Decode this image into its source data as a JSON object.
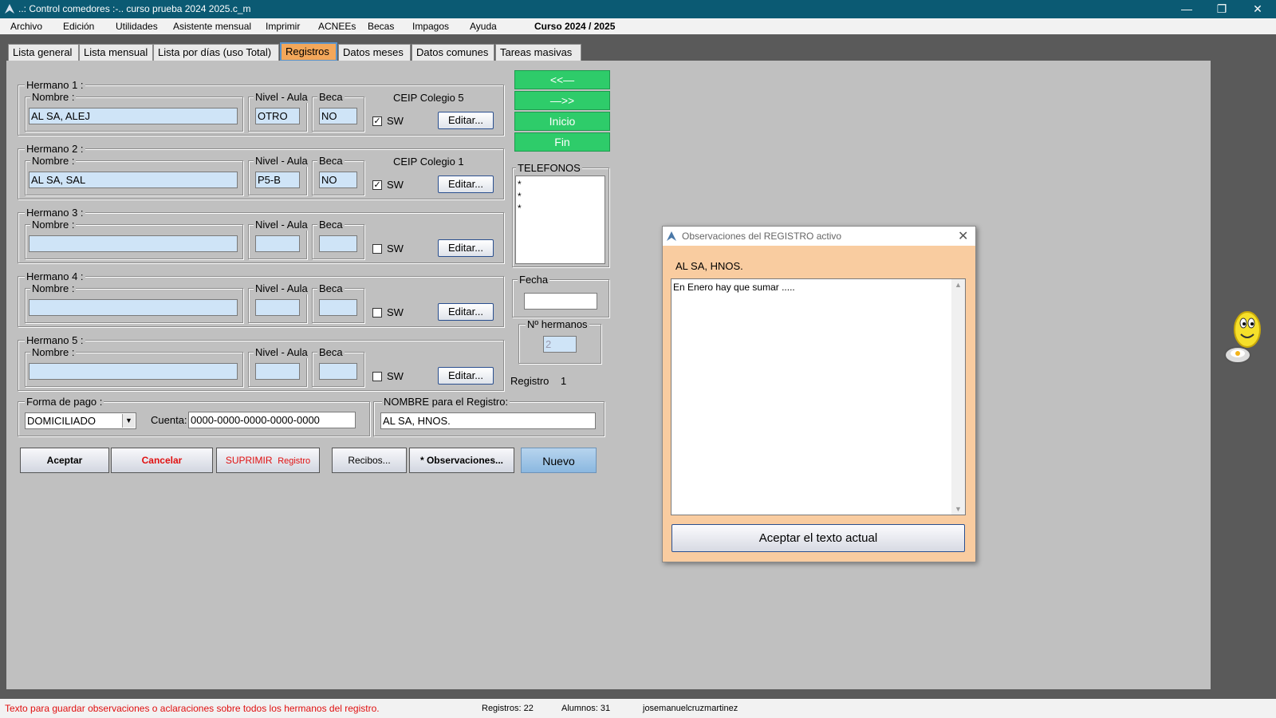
{
  "window": {
    "title": "..: Control comedores :-..   curso prueba 2024 2025.c_m"
  },
  "menu": {
    "items": [
      "Archivo",
      "Edición",
      "Utilidades",
      "Asistente mensual",
      "Imprimir",
      "ACNEEs",
      "Becas",
      "Impagos",
      "Ayuda"
    ],
    "course": "Curso 2024 / 2025"
  },
  "tabs": [
    "Lista general",
    "Lista mensual",
    "Lista por días (uso Total)",
    "Registros",
    "Datos meses",
    "Datos comunes",
    "Tareas masivas"
  ],
  "labels": {
    "nombre": "Nombre :",
    "nivel": "Nivel - Aula",
    "beca": "Beca",
    "sw": "SW",
    "editar": "Editar..."
  },
  "hermanos": [
    {
      "label": "Hermano 1 :",
      "nombre": "AL SA, ALEJ",
      "nivel": "OTRO",
      "beca": "NO",
      "colegio": "CEIP Colegio 5",
      "sw": true
    },
    {
      "label": "Hermano 2 :",
      "nombre": "AL SA, SAL",
      "nivel": "P5-B",
      "beca": "NO",
      "colegio": "CEIP Colegio 1",
      "sw": true
    },
    {
      "label": "Hermano 3 :",
      "nombre": "",
      "nivel": "",
      "beca": "",
      "colegio": "",
      "sw": false
    },
    {
      "label": "Hermano 4 :",
      "nombre": "",
      "nivel": "",
      "beca": "",
      "colegio": "",
      "sw": false
    },
    {
      "label": "Hermano 5 :",
      "nombre": "",
      "nivel": "",
      "beca": "",
      "colegio": "",
      "sw": false
    }
  ],
  "nav": {
    "prev": "<<—",
    "next": "—>>",
    "inicio": "Inicio",
    "fin": "Fin"
  },
  "telefonos": {
    "label": "TELEFONOS",
    "lines": [
      "*",
      "*",
      "*"
    ]
  },
  "fecha": {
    "label": "Fecha",
    "value": ""
  },
  "nhermanos": {
    "label": "Nº hermanos",
    "value": "2"
  },
  "registro": {
    "label": "Registro",
    "value": "1"
  },
  "pago": {
    "label": "Forma de pago :",
    "value": "DOMICILIADO",
    "cuenta_label": "Cuenta:",
    "cuenta": "0000-0000-0000-0000-0000"
  },
  "nombre_registro": {
    "label": "NOMBRE para el Registro:",
    "value": "AL SA, HNOS."
  },
  "buttons": {
    "aceptar": "Aceptar",
    "cancelar": "Cancelar",
    "suprimir": "SUPRIMIR",
    "suprimir2": "Registro",
    "recibos": "Recibos...",
    "observaciones": "* Observaciones...",
    "nuevo": "Nuevo"
  },
  "dialog": {
    "title": "Observaciones del REGISTRO activo",
    "name": "AL SA, HNOS.",
    "text": "En Enero hay que sumar .....",
    "accept": "Aceptar el texto actual"
  },
  "status": {
    "hint": "Texto para guardar observaciones o aclaraciones sobre todos los hermanos del registro.",
    "registros": "Registros: 22",
    "alumnos": "Alumnos: 31",
    "user": "josemanuelcruzmartinez"
  },
  "colors": {
    "titlebar": "#0b5a73",
    "client": "#c0c0c0",
    "input": "#cfe4f7",
    "green": "#2ecc6a",
    "tab_active": "#f3a75a",
    "dialog": "#f9cca0",
    "status_hint": "#e01010"
  }
}
